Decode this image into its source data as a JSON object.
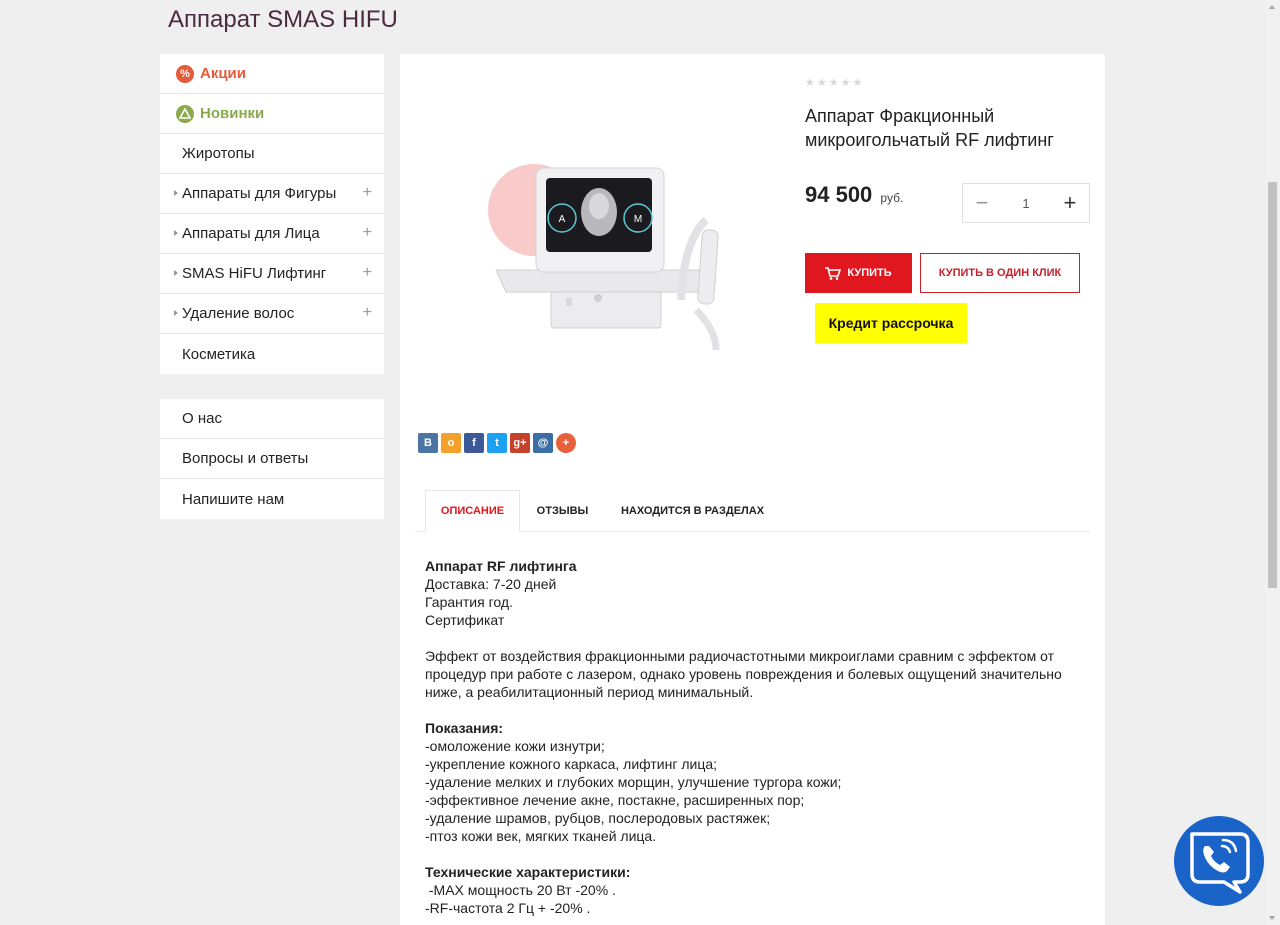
{
  "page": {
    "title": "Аппарат SMAS HIFU"
  },
  "sidebar": {
    "items": [
      {
        "label": "Акции",
        "icon": "percent-badge-icon",
        "expandable": false
      },
      {
        "label": "Новинки",
        "icon": "new-badge-icon",
        "expandable": false
      },
      {
        "label": "Жиротопы",
        "expandable": false
      },
      {
        "label": "Аппараты для Фигуры",
        "expandable": true
      },
      {
        "label": "Аппараты для Лица",
        "expandable": true
      },
      {
        "label": "SMAS HiFU Лифтинг",
        "expandable": true
      },
      {
        "label": "Удаление волос",
        "expandable": true
      },
      {
        "label": "Косметика",
        "expandable": false
      }
    ],
    "plus_symbol": "+",
    "promo_symbol": "%"
  },
  "info_menu": {
    "items": [
      {
        "label": "О нас"
      },
      {
        "label": "Вопросы и ответы"
      },
      {
        "label": "Напишите нам"
      }
    ]
  },
  "product": {
    "name": "Аппарат Фракционный микроигольчатый RF лифтинг",
    "price": "94 500",
    "currency": "руб.",
    "quantity": "1",
    "rating": 0,
    "rating_max": 5,
    "minus_symbol": "−",
    "plus_symbol": "+",
    "image_labels": {
      "left": "A",
      "right": "M"
    },
    "buy_label": "Купить",
    "oneclick_label": "Купить в один клик",
    "credit_label": "Кредит рассрочка"
  },
  "share": {
    "buttons": [
      {
        "name": "vk",
        "glyph": "В",
        "color": "#4c75a3"
      },
      {
        "name": "odnoklassniki",
        "glyph": "о",
        "color": "#f2a12c"
      },
      {
        "name": "facebook",
        "glyph": "f",
        "color": "#3b5998"
      },
      {
        "name": "twitter",
        "glyph": "t",
        "color": "#1da1f2"
      },
      {
        "name": "googleplus",
        "glyph": "g+",
        "color": "#c5412b"
      },
      {
        "name": "mailru",
        "glyph": "@",
        "color": "#3a6ea5"
      },
      {
        "name": "more",
        "glyph": "+",
        "color": "#e8603c"
      }
    ]
  },
  "tabs": {
    "description": "Описание",
    "reviews": "Отзывы",
    "sections": "Находится в разделах"
  },
  "description": {
    "heading": "Аппарат RF лифтинга",
    "delivery": "Доставка: 7-20 дней",
    "warranty": "Гарантия год.",
    "certificate": "Сертификат",
    "effect": "Эффект от воздействия фракционными радиочастотными микроиглами сравним с эффектом от процедур при работе с лазером, однако уровень повреждения и болевых ощущений значительно ниже, а реабилитационный период минимальный.",
    "indications_title": "Показания:",
    "indications": [
      "-омоложение кожи изнутри;",
      "-укрепление кожного каркаса, лифтинг лица;",
      "-удаление мелких и глубоких морщин, улучшение тургора кожи;",
      "-эффективное лечение акне, постакне, расширенных пор;",
      "-удаление шрамов, рубцов, послеродовых растяжек;",
      "-птоз кожи век, мягких тканей лица."
    ],
    "specs_title": "Технические характеристики:",
    "specs": [
      " -MAX мощность 20 Вт -20% .",
      "-RF-частота 2 Гц + -20% ."
    ]
  },
  "colors": {
    "accent_red": "#e1171f",
    "promo_orange": "#e45b3c",
    "new_green": "#8aaa4b",
    "credit_yellow": "#ffff00",
    "call_blue": "#1a63c8"
  }
}
